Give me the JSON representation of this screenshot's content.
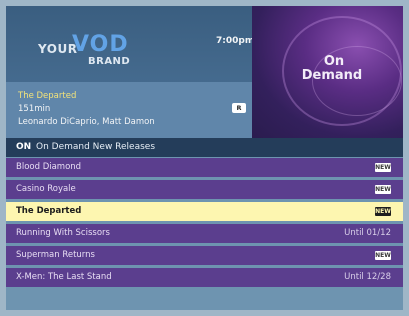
{
  "header": {
    "brand": {
      "your": "YOUR",
      "vod": "VOD",
      "brand": "BRAND"
    },
    "clock": "7:00pm",
    "logo": {
      "on": "On",
      "demand": "Demand"
    }
  },
  "detail": {
    "title": "The Departed",
    "runtime": "151min",
    "rating": "R",
    "cast": "Leonardo DiCaprio, Matt Damon"
  },
  "category": {
    "on": "ON",
    "label": "On Demand New Releases"
  },
  "list": {
    "items": [
      {
        "title": "Blood Diamond",
        "tag": "NEW",
        "until": ""
      },
      {
        "title": "Casino Royale",
        "tag": "NEW",
        "until": ""
      },
      {
        "title": "The Departed",
        "tag": "NEW",
        "until": "",
        "selected": true
      },
      {
        "title": "Running With Scissors",
        "tag": "",
        "until": "Until 01/12"
      },
      {
        "title": "Superman Returns",
        "tag": "NEW",
        "until": ""
      },
      {
        "title": "X-Men: The Last Stand",
        "tag": "",
        "until": "Until 12/28"
      }
    ]
  },
  "colors": {
    "highlight": "#fdf6b0",
    "list_row": "#5b3e8e",
    "header": "#3a5e80",
    "category_bar": "#243d5a"
  }
}
